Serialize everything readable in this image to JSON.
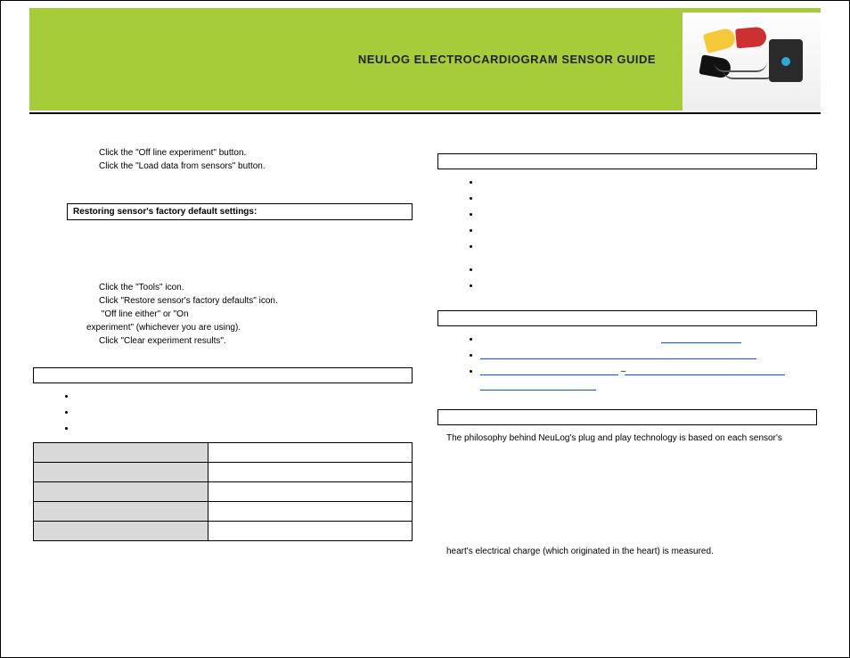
{
  "header": {
    "title": "NEULOG ELECTROCARDIOGRAM SENSOR GUIDE"
  },
  "left": {
    "first_instructions": [
      "Click the \"Off line experiment\" button.",
      "Click the \"Load data from sensors\" button."
    ],
    "restore_heading": "Restoring sensor's factory default settings:",
    "restore_steps": [
      "Click the \"Tools\" icon.",
      "Click \"Restore sensor's factory defaults\" icon.",
      "                                                          \"Off line either\" or \"On",
      "experiment\" (whichever you are using).",
      "Click \"Clear experiment results\"."
    ],
    "spec_rows": [
      {
        "label": "",
        "value": ""
      },
      {
        "label": "",
        "value": ""
      },
      {
        "label": "",
        "value": ""
      },
      {
        "label": "",
        "value": ""
      },
      {
        "label": "",
        "value": ""
      }
    ]
  },
  "right": {
    "box1_heading": "",
    "list1": [
      "",
      "",
      "",
      "",
      "",
      "",
      ""
    ],
    "box2_heading": "",
    "link1_text": "",
    "link2_text_pre": "",
    "link2_sep": " – ",
    "link3_text": "",
    "box3_heading": "",
    "para1": "The philosophy behind NeuLog's plug and play technology is based on each sensor's",
    "para2": "heart's electrical charge (which originated in the heart) is measured."
  }
}
